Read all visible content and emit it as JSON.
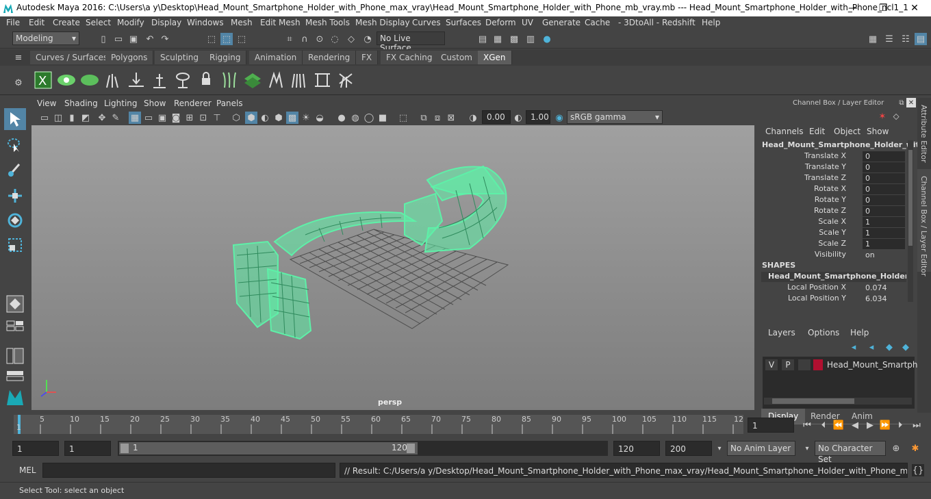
{
  "window": {
    "title": "Autodesk Maya 2016: C:\\Users\\a y\\Desktop\\Head_Mount_Smartphone_Holder_with_Phone_max_vray\\Head_Mount_Smartphone_Holder_with_Phone_mb_vray.mb   ---   Head_Mount_Smartphone_Holder_with_Phone_ncl1_1",
    "minimize": "—",
    "maximize": "❐",
    "close": "✕"
  },
  "menu": [
    "File",
    "Edit",
    "Create",
    "Select",
    "Modify",
    "Display",
    "Windows",
    "Mesh",
    "Edit Mesh",
    "Mesh Tools",
    "Mesh Display",
    "Curves",
    "Surfaces",
    "Deform",
    "UV",
    "Generate",
    "Cache",
    "- 3DtoAll -",
    "Redshift",
    "Help"
  ],
  "status": {
    "mode": "Modeling",
    "live_surface": "No Live Surface"
  },
  "shelf_tabs": [
    "Curves / Surfaces",
    "Polygons",
    "Sculpting",
    "Rigging",
    "Animation",
    "Rendering",
    "FX",
    "FX Caching",
    "Custom",
    "XGen"
  ],
  "active_shelf_tab": "XGen",
  "panel_menu": [
    "View",
    "Shading",
    "Lighting",
    "Show",
    "Renderer",
    "Panels"
  ],
  "panel_toolbar": {
    "exposure": "0.00",
    "gamma": "1.00",
    "color_space": "sRGB gamma"
  },
  "viewport": {
    "camera_label": "persp"
  },
  "channel_box": {
    "header": "Channel Box / Layer Editor",
    "menu": [
      "Channels",
      "Edit",
      "Object",
      "Show"
    ],
    "object_name": "Head_Mount_Smartphone_Holder_wit...",
    "attributes": [
      {
        "label": "Translate X",
        "value": "0"
      },
      {
        "label": "Translate Y",
        "value": "0"
      },
      {
        "label": "Translate Z",
        "value": "0"
      },
      {
        "label": "Rotate X",
        "value": "0"
      },
      {
        "label": "Rotate Y",
        "value": "0"
      },
      {
        "label": "Rotate Z",
        "value": "0"
      },
      {
        "label": "Scale X",
        "value": "1"
      },
      {
        "label": "Scale Y",
        "value": "1"
      },
      {
        "label": "Scale Z",
        "value": "1"
      },
      {
        "label": "Visibility",
        "value": "on"
      }
    ],
    "shapes_header": "SHAPES",
    "shape_name": "Head_Mount_Smartphone_Holder_...",
    "shape_attributes": [
      {
        "label": "Local Position X",
        "value": "0.074"
      },
      {
        "label": "Local Position Y",
        "value": "6.034"
      }
    ]
  },
  "side_tabs": {
    "attribute_editor": "Attribute Editor",
    "channel_box": "Channel Box / Layer Editor"
  },
  "layer_editor": {
    "tabs": [
      "Display",
      "Render",
      "Anim"
    ],
    "active_tab": "Display",
    "menu": [
      "Layers",
      "Options",
      "Help"
    ],
    "layer": {
      "v": "V",
      "p": "P",
      "name": "Head_Mount_Smartphor",
      "color": "#b01030"
    }
  },
  "timeline": {
    "ticks": [
      "1",
      "5",
      "10",
      "15",
      "20",
      "25",
      "30",
      "35",
      "40",
      "45",
      "50",
      "55",
      "60",
      "65",
      "70",
      "75",
      "80",
      "85",
      "90",
      "95",
      "100",
      "105",
      "110",
      "115",
      "12"
    ],
    "current_frame": "1"
  },
  "range": {
    "start": "1",
    "playback_start": "1",
    "slider_start": "1",
    "slider_end": "120",
    "playback_end": "120",
    "end": "200",
    "anim_layer": "No Anim Layer",
    "character_set": "No Character Set"
  },
  "command": {
    "label": "MEL",
    "result": "// Result: C:/Users/a y/Desktop/Head_Mount_Smartphone_Holder_with_Phone_max_vray/Head_Mount_Smartphone_Holder_with_Phone_mb_vray.mb"
  },
  "help_line": "Select Tool: select an object",
  "colors": {
    "wireframe": "#5ef0a8",
    "ui_bg": "#444444",
    "field_bg": "#2b2b2b",
    "active_blue": "#5285a6"
  }
}
